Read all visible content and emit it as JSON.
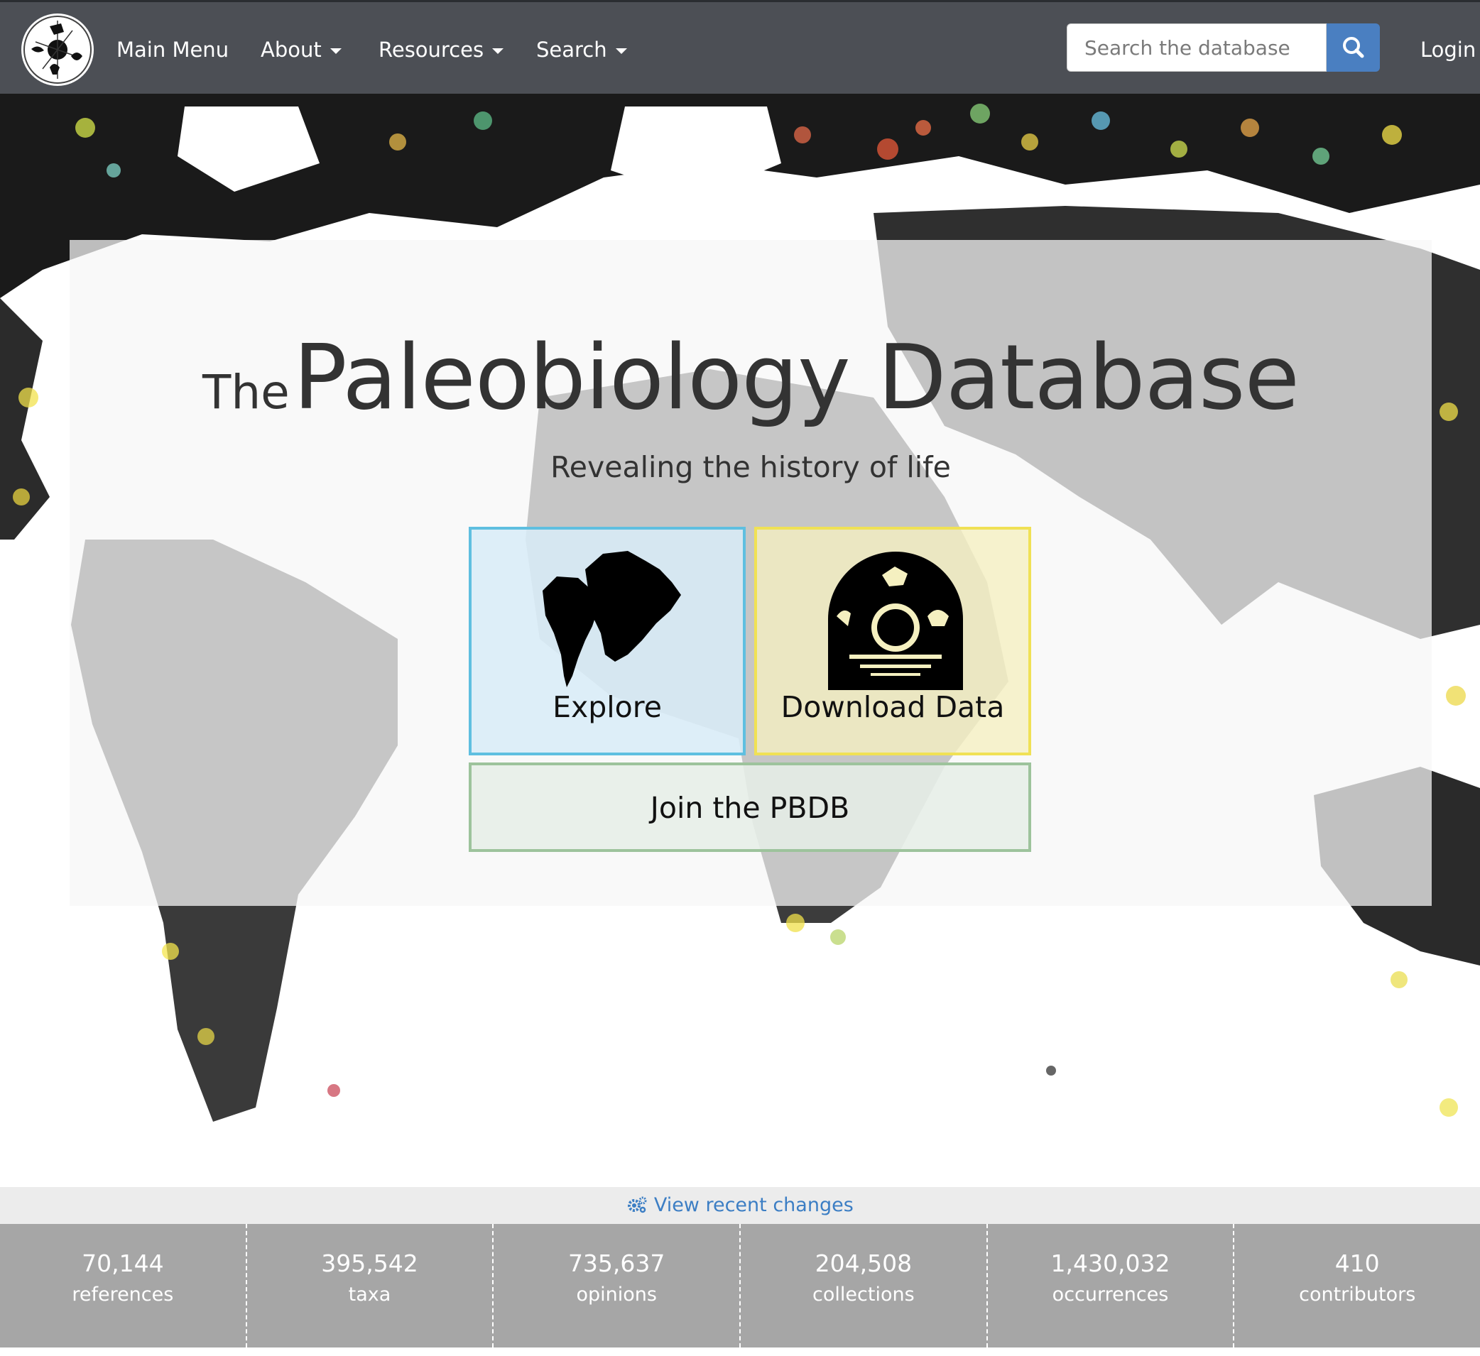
{
  "nav": {
    "items": [
      {
        "label": "Main Menu",
        "dropdown": false
      },
      {
        "label": "About",
        "dropdown": true
      },
      {
        "label": "Resources",
        "dropdown": true
      },
      {
        "label": "Search",
        "dropdown": true
      }
    ],
    "search_placeholder": "Search the database",
    "search_icon": "search-icon",
    "login_label": "Login"
  },
  "hero": {
    "title_prefix": "The",
    "title_main": "Paleobiology Database",
    "subtitle": "Revealing the history of life",
    "explore_label": "Explore",
    "explore_icon": "continents-icon",
    "download_label": "Download Data",
    "download_icon": "fossil-dome-icon",
    "join_label": "Join the PBDB"
  },
  "footer": {
    "recent_label": "View recent changes",
    "recent_icon": "gears-icon",
    "stats": [
      {
        "value": "70,144",
        "label": "references"
      },
      {
        "value": "395,542",
        "label": "taxa"
      },
      {
        "value": "735,637",
        "label": "opinions"
      },
      {
        "value": "204,508",
        "collections": true,
        "label": "collections"
      },
      {
        "value": "1,430,032",
        "label": "occurrences"
      },
      {
        "value": "410",
        "label": "contributors"
      }
    ]
  },
  "colors": {
    "navbar": "#3e4248",
    "search_button": "#4a7fc1",
    "explore_border": "#5fbfe0",
    "download_border": "#f0e155",
    "join_border": "#9dc39c",
    "stats_bg": "#a6a6a6",
    "link": "#3c7ec4"
  }
}
